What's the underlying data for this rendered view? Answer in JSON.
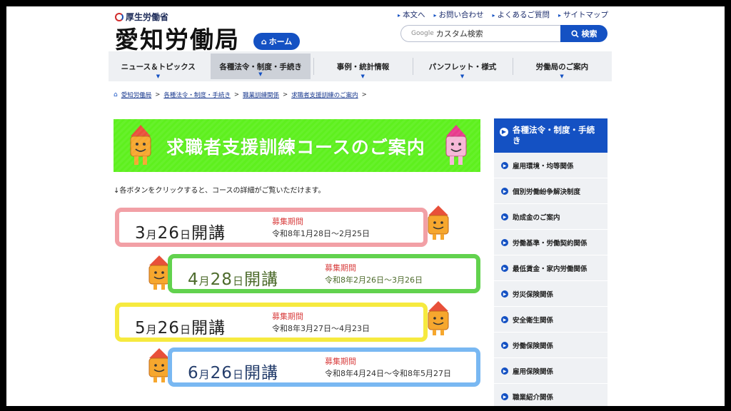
{
  "header": {
    "ministry": "厚生労働省",
    "site_title": "愛知労働局",
    "home_label": "ホーム",
    "util_links": [
      "本文へ",
      "お問い合わせ",
      "よくあるご質問",
      "サイトマップ"
    ],
    "search_brand": "Google",
    "search_placeholder": "カスタム検索",
    "search_button": "検索"
  },
  "nav": {
    "items": [
      "ニュース＆トピックス",
      "各種法令・制度・手続き",
      "事例・統計情報",
      "パンフレット・様式",
      "労働局のご案内"
    ],
    "active_index": 1
  },
  "breadcrumb": [
    "愛知労働局",
    "各種法令・制度・手続き",
    "職業訓練関係",
    "求職者支援訓練のご案内"
  ],
  "banner": {
    "title": "求職者支援訓練コースのご案内"
  },
  "intro": "↓各ボタンをクリックすると、コースの詳細がご覧いただけます。",
  "courses": [
    {
      "month": "3",
      "day": "26",
      "suffix": "開講",
      "period_label": "募集期間",
      "period": "令和8年1月28日～2月25日"
    },
    {
      "month": "4",
      "day": "28",
      "suffix": "開講",
      "period_label": "募集期間",
      "period": "令和8年2月26日～3月26日"
    },
    {
      "month": "5",
      "day": "26",
      "suffix": "開講",
      "period_label": "募集期間",
      "period": "令和8年3月27日～4月23日"
    },
    {
      "month": "6",
      "day": "26",
      "suffix": "開講",
      "period_label": "募集期間",
      "period": "令和8年4月24日～令和8年5月27日"
    }
  ],
  "sidebar": {
    "heading": "各種法令・制度・手続き",
    "items": [
      "雇用環境・均等関係",
      "個別労働紛争解決制度",
      "助成金のご案内",
      "労働基準・労働契約関係",
      "最低賃金・家内労働関係",
      "労災保険関係",
      "安全衛生関係",
      "労働保険関係",
      "雇用保険関係",
      "職業紹介関係"
    ]
  },
  "colors": {
    "brand_blue": "#1451c3",
    "banner_green": "#5ef01e"
  }
}
